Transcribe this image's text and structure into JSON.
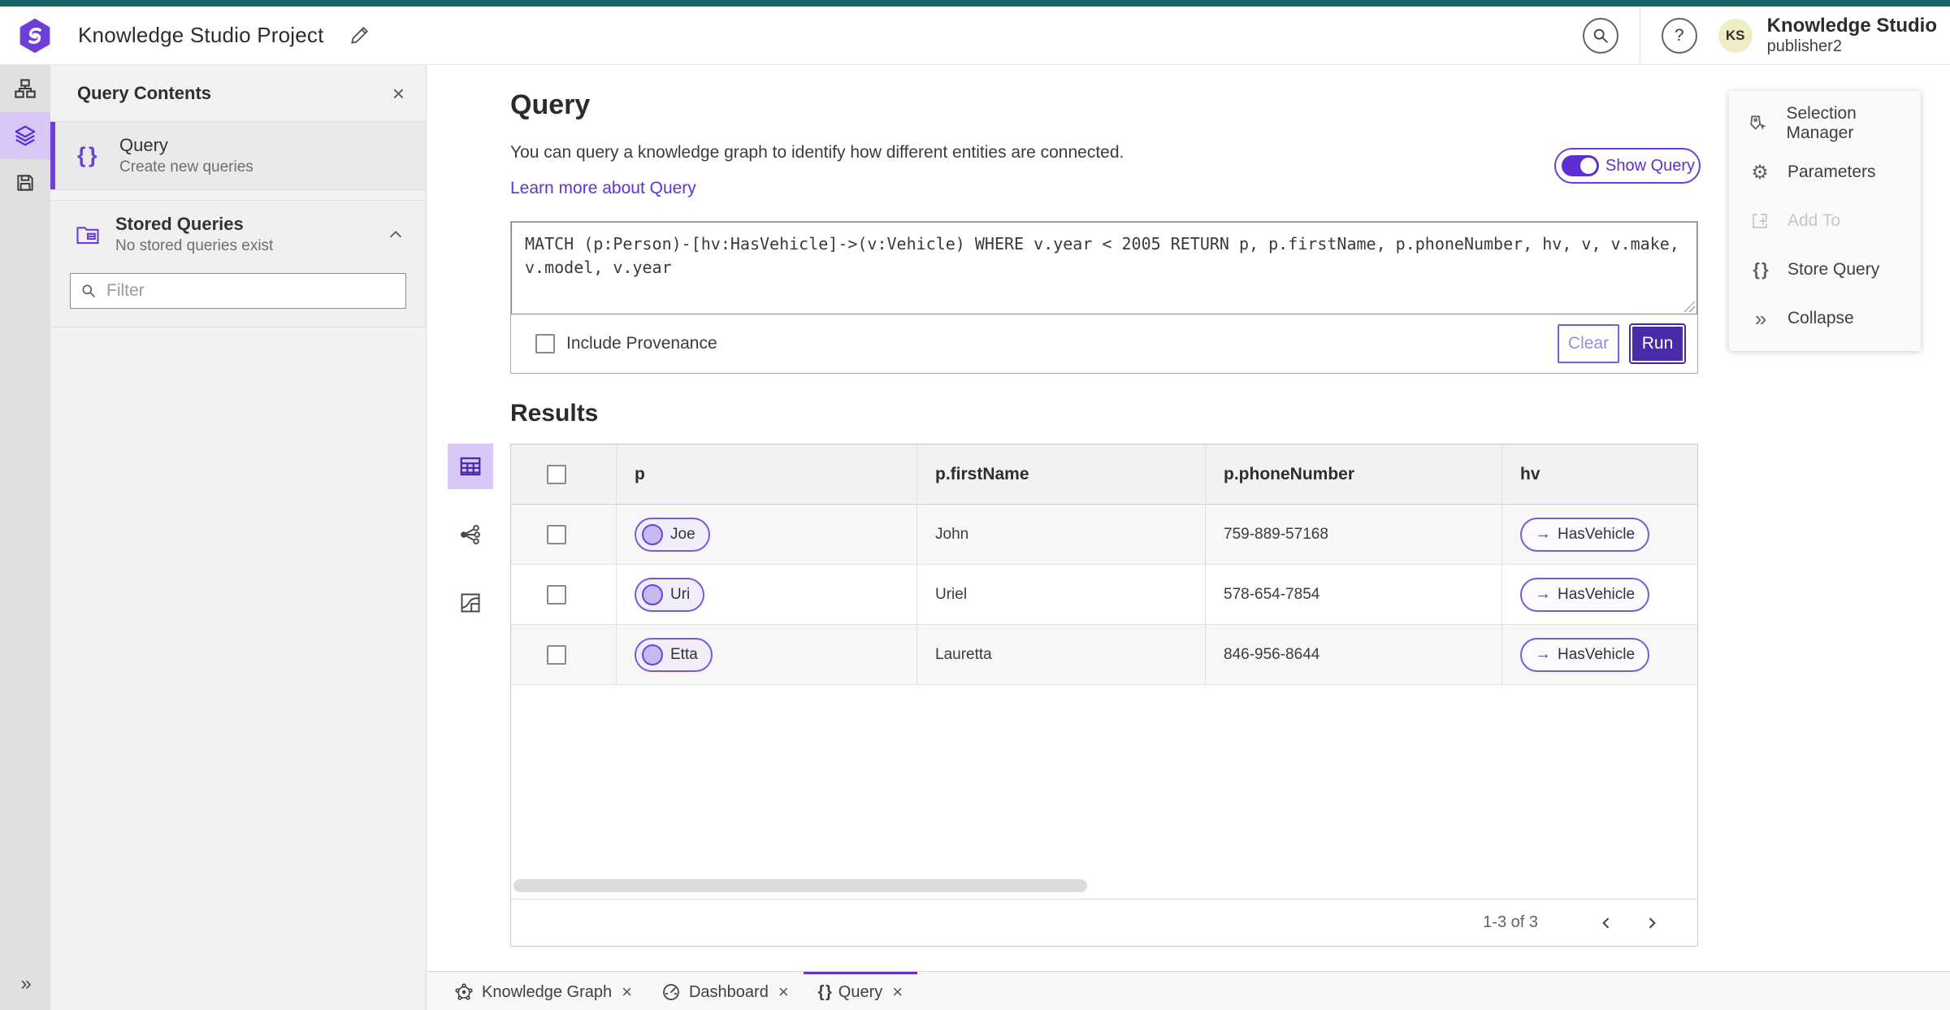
{
  "colors": {
    "accent_purple": "#6133d3",
    "deep_purple": "#4b2aa9",
    "toggle_purple": "#5d2fd0",
    "teal_top": "#156567",
    "selected_lavender": "#d9c7f7"
  },
  "header": {
    "title": "Knowledge Studio Project",
    "product": "Knowledge Studio",
    "user": "publisher2",
    "avatar_initials": "KS"
  },
  "panel": {
    "title": "Query Contents",
    "query_item": {
      "label": "Query",
      "description": "Create new queries"
    },
    "stored": {
      "label": "Stored Queries",
      "description": "No stored queries exist"
    },
    "filter_placeholder": "Filter"
  },
  "main": {
    "heading": "Query",
    "description": "You can query a knowledge graph to identify how different entities are connected.",
    "link": "Learn more about Query",
    "show_query_label": "Show Query",
    "query_text": "MATCH (p:Person)-[hv:HasVehicle]->(v:Vehicle) WHERE v.year < 2005 RETURN p, p.firstName, p.phoneNumber, hv, v, v.make, v.model, v.year",
    "include_provenance": "Include Provenance",
    "clear_label": "Clear",
    "run_label": "Run",
    "results_heading": "Results"
  },
  "table": {
    "columns": [
      "p",
      "p.firstName",
      "p.phoneNumber",
      "hv"
    ],
    "rows": [
      {
        "node": "Joe",
        "firstName": "John",
        "phone": "759-889-57168",
        "edge": "HasVehicle"
      },
      {
        "node": "Uri",
        "firstName": "Uriel",
        "phone": "578-654-7854",
        "edge": "HasVehicle"
      },
      {
        "node": "Etta",
        "firstName": "Lauretta",
        "phone": "846-956-8644",
        "edge": "HasVehicle"
      }
    ],
    "pagination": "1-3 of 3"
  },
  "context_menu": {
    "items": [
      {
        "label": "Selection Manager"
      },
      {
        "label": "Parameters"
      },
      {
        "label": "Add To"
      },
      {
        "label": "Store Query"
      },
      {
        "label": "Collapse"
      }
    ]
  },
  "tabs": [
    {
      "label": "Knowledge Graph"
    },
    {
      "label": "Dashboard"
    },
    {
      "label": "Query"
    }
  ],
  "icons": {
    "edit": "✎",
    "close": "×",
    "question": "?",
    "braces": "{ }",
    "double_chevron_right": "»",
    "arrow_right": "→",
    "gear": "⚙"
  }
}
